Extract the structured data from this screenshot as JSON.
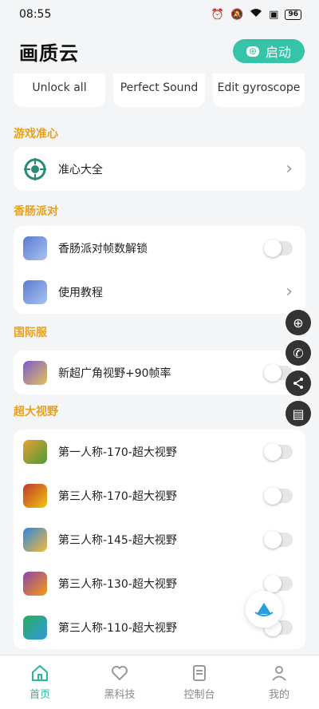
{
  "status": {
    "time": "08:55",
    "battery": "96"
  },
  "header": {
    "title": "画质云",
    "launch_label": "启动"
  },
  "features": [
    "Unlock all",
    "Perfect Sound",
    "Edit gyroscope"
  ],
  "sections": [
    {
      "title": "游戏准心",
      "rows": [
        {
          "label": "准心大全",
          "control": "chevron"
        }
      ]
    },
    {
      "title": "香肠派对",
      "rows": [
        {
          "label": "香肠派对帧数解锁",
          "control": "toggle"
        },
        {
          "label": "使用教程",
          "control": "chevron"
        }
      ]
    },
    {
      "title": "国际服",
      "rows": [
        {
          "label": "新超广角视野+90帧率",
          "control": "toggle"
        }
      ]
    },
    {
      "title": "超大视野",
      "rows": [
        {
          "label": "第一人称-170-超大视野",
          "control": "toggle"
        },
        {
          "label": "第三人称-170-超大视野",
          "control": "toggle"
        },
        {
          "label": "第三人称-145-超大视野",
          "control": "toggle"
        },
        {
          "label": "第三人称-130-超大视野",
          "control": "toggle"
        },
        {
          "label": "第三人称-110-超大视野",
          "control": "toggle"
        }
      ]
    }
  ],
  "tabs": [
    "首页",
    "黑科技",
    "控制台",
    "我的"
  ],
  "colors": {
    "accent": "#36c4a8",
    "section": "#e8a020",
    "tab_active": "#2bb59a"
  }
}
